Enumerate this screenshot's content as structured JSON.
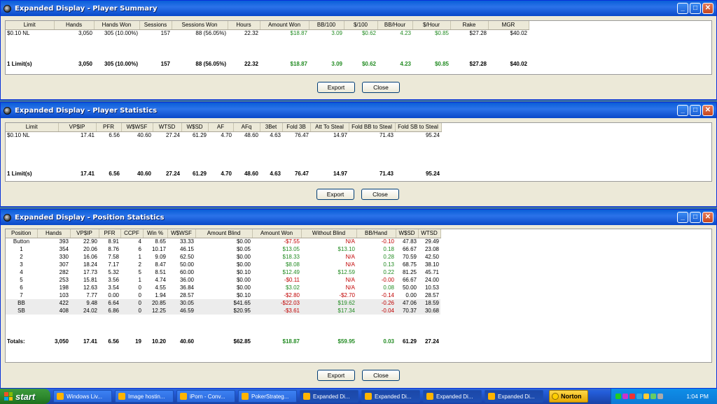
{
  "windows": [
    {
      "title": "Expanded Display - Player Summary",
      "columns": [
        "Limit",
        "Hands",
        "Hands Won",
        "Sessions",
        "Sessions Won",
        "Hours",
        "Amount Won",
        "BB/100",
        "$/100",
        "BB/Hour",
        "$/Hour",
        "Rake",
        "MGR"
      ],
      "rows": [
        [
          "$0.10 NL",
          "3,050",
          "305 (10.00%)",
          "157",
          "88 (56.05%)",
          "22.32",
          "$18.87",
          "3.09",
          "$0.62",
          "4.23",
          "$0.85",
          "$27.28",
          "$40.02"
        ]
      ],
      "totals": [
        "1 Limit(s)",
        "3,050",
        "305 (10.00%)",
        "157",
        "88 (56.05%)",
        "22.32",
        "$18.87",
        "3.09",
        "$0.62",
        "4.23",
        "$0.85",
        "$27.28",
        "$40.02"
      ],
      "buttons": {
        "export": "Export",
        "close": "Close"
      }
    },
    {
      "title": "Expanded Display - Player Statistics",
      "columns": [
        "Limit",
        "VP$IP",
        "PFR",
        "W$WSF",
        "WTSD",
        "W$SD",
        "AF",
        "AFq",
        "3Bet",
        "Fold 3B",
        "Att To Steal",
        "Fold BB to Steal",
        "Fold SB to Steal"
      ],
      "rows": [
        [
          "$0.10 NL",
          "17.41",
          "6.56",
          "40.60",
          "27.24",
          "61.29",
          "4.70",
          "48.60",
          "4.63",
          "76.47",
          "14.97",
          "71.43",
          "95.24"
        ]
      ],
      "totals": [
        "1 Limit(s)",
        "17.41",
        "6.56",
        "40.60",
        "27.24",
        "61.29",
        "4.70",
        "48.60",
        "4.63",
        "76.47",
        "14.97",
        "71.43",
        "95.24"
      ],
      "buttons": {
        "export": "Export",
        "close": "Close"
      }
    },
    {
      "title": "Expanded Display - Position Statistics",
      "columns": [
        "Position",
        "Hands",
        "VP$IP",
        "PFR",
        "CCPF",
        "Win %",
        "W$WSF",
        "Amount Blind",
        "Amount Won",
        "Without Blind",
        "BB/Hand",
        "W$SD",
        "WTSD"
      ],
      "rows": [
        [
          "Button",
          "393",
          "22.90",
          "8.91",
          "4",
          "8.65",
          "33.33",
          "$0.00",
          "-$7.55",
          "N/A",
          "-0.10",
          "47.83",
          "29.49"
        ],
        [
          "1",
          "354",
          "20.06",
          "8.76",
          "6",
          "10.17",
          "46.15",
          "$0.05",
          "$13.05",
          "$13.10",
          "0.18",
          "66.67",
          "23.08"
        ],
        [
          "2",
          "330",
          "16.06",
          "7.58",
          "1",
          "9.09",
          "62.50",
          "$0.00",
          "$18.33",
          "N/A",
          "0.28",
          "70.59",
          "42.50"
        ],
        [
          "3",
          "307",
          "18.24",
          "7.17",
          "2",
          "8.47",
          "50.00",
          "$0.00",
          "$8.08",
          "N/A",
          "0.13",
          "68.75",
          "38.10"
        ],
        [
          "4",
          "282",
          "17.73",
          "5.32",
          "5",
          "8.51",
          "60.00",
          "$0.10",
          "$12.49",
          "$12.59",
          "0.22",
          "81.25",
          "45.71"
        ],
        [
          "5",
          "253",
          "15.81",
          "3.56",
          "1",
          "4.74",
          "36.00",
          "$0.00",
          "-$0.11",
          "N/A",
          "-0.00",
          "66.67",
          "24.00"
        ],
        [
          "6",
          "198",
          "12.63",
          "3.54",
          "0",
          "4.55",
          "36.84",
          "$0.00",
          "$3.02",
          "N/A",
          "0.08",
          "50.00",
          "10.53"
        ],
        [
          "7",
          "103",
          "7.77",
          "0.00",
          "0",
          "1.94",
          "28.57",
          "$0.10",
          "-$2.80",
          "-$2.70",
          "-0.14",
          "0.00",
          "28.57"
        ],
        [
          "BB",
          "422",
          "9.48",
          "6.64",
          "0",
          "20.85",
          "30.05",
          "$41.65",
          "-$22.03",
          "$19.62",
          "-0.26",
          "47.06",
          "18.59"
        ],
        [
          "SB",
          "408",
          "24.02",
          "6.86",
          "0",
          "12.25",
          "46.59",
          "$20.95",
          "-$3.61",
          "$17.34",
          "-0.04",
          "70.37",
          "30.68"
        ]
      ],
      "totals": [
        "Totals:",
        "3,050",
        "17.41",
        "6.56",
        "19",
        "10.20",
        "40.60",
        "$62.85",
        "$18.87",
        "$59.95",
        "0.03",
        "61.29",
        "27.24"
      ],
      "buttons": {
        "export": "Export",
        "close": "Close"
      }
    }
  ],
  "taskbar": {
    "start": "start",
    "items": [
      "Windows Liv...",
      "Image hostin...",
      "iPorn - Conv...",
      "PokerStrateg...",
      "Expanded Di...",
      "Expanded Di...",
      "Expanded Di...",
      "Expanded Di..."
    ],
    "norton": "Norton",
    "clock": "1:04 PM"
  },
  "colors": {
    "positive": "#228b22",
    "negative": "#c00000",
    "title_bar": "#0a5fd8"
  }
}
